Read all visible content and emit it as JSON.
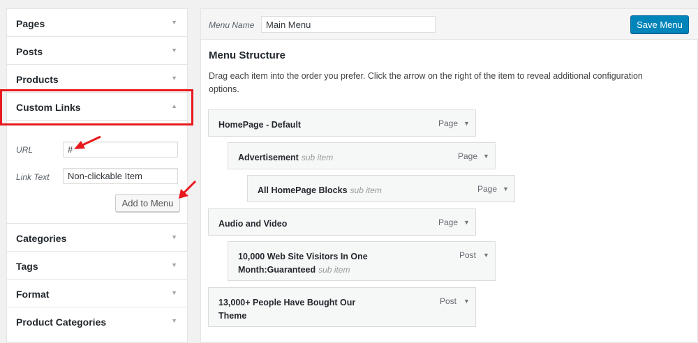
{
  "left_panel": {
    "sections_top": [
      {
        "label": "Pages"
      },
      {
        "label": "Posts"
      },
      {
        "label": "Products"
      }
    ],
    "custom_links": {
      "label": "Custom Links",
      "url_label": "URL",
      "url_value": "#",
      "link_text_label": "Link Text",
      "link_text_value": "Non-clickable Item",
      "add_button": "Add to Menu"
    },
    "sections_bottom": [
      {
        "label": "Categories"
      },
      {
        "label": "Tags"
      },
      {
        "label": "Format"
      },
      {
        "label": "Product Categories"
      }
    ],
    "arrow_down": "▼",
    "arrow_up": "▲"
  },
  "menu_editor": {
    "menu_name_label": "Menu Name",
    "menu_name_value": "Main Menu",
    "save_button": "Save Menu",
    "structure_title": "Menu Structure",
    "structure_desc": "Drag each item into the order you prefer. Click the arrow on the right of the item to reveal additional configuration options.",
    "items": [
      {
        "title": "HomePage - Default",
        "sub": "",
        "type": "Page"
      },
      {
        "title": "Advertisement",
        "sub": "sub item",
        "type": "Page"
      },
      {
        "title": "All HomePage Blocks",
        "sub": "sub item",
        "type": "Page"
      },
      {
        "title": "Audio and Video",
        "sub": "",
        "type": "Page"
      },
      {
        "title": "10,000 Web Site Visitors In One Month:Guaranteed",
        "sub": "sub item",
        "type": "Post"
      },
      {
        "title": "13,000+ People Have Bought Our Theme",
        "sub": "",
        "type": "Post"
      }
    ]
  },
  "colors": {
    "annotation_red": "#e8191d",
    "primary_blue": "#0085ba"
  }
}
